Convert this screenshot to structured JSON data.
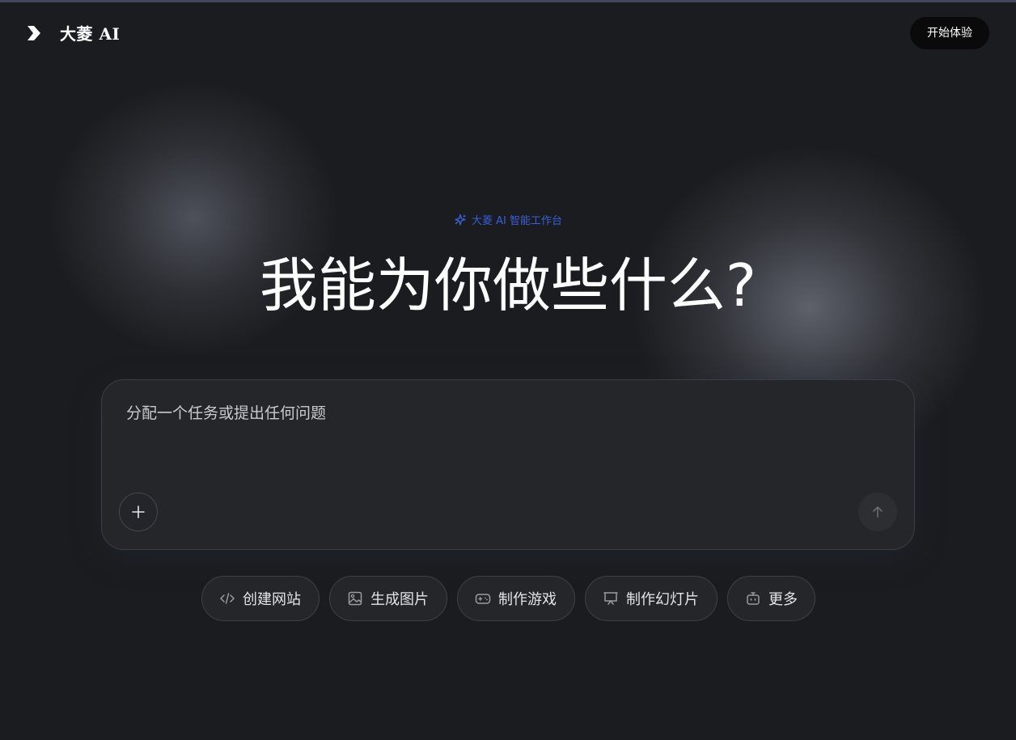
{
  "header": {
    "brand": "大菱 AI",
    "start_button": "开始体验"
  },
  "hero": {
    "tagline": "大菱 AI 智能工作台",
    "title": "我能为你做些什么?"
  },
  "composer": {
    "placeholder": "分配一个任务或提出任何问题"
  },
  "actions": [
    {
      "label": "创建网站",
      "icon": "code-icon"
    },
    {
      "label": "生成图片",
      "icon": "image-icon"
    },
    {
      "label": "制作游戏",
      "icon": "gamepad-icon"
    },
    {
      "label": "制作幻灯片",
      "icon": "presentation-icon"
    },
    {
      "label": "更多",
      "icon": "robot-icon"
    }
  ],
  "colors": {
    "background": "#1b1c1f",
    "accent": "#3b5fd9",
    "panel": "#25262a"
  }
}
